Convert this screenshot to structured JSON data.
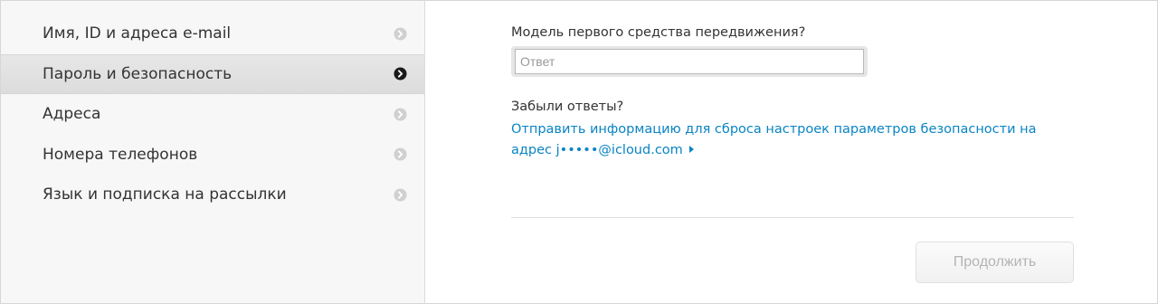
{
  "sidebar": {
    "items": [
      {
        "label": "Имя, ID и адреса e-mail",
        "active": false
      },
      {
        "label": "Пароль и безопасность",
        "active": true
      },
      {
        "label": "Адреса",
        "active": false
      },
      {
        "label": "Номера телефонов",
        "active": false
      },
      {
        "label": "Язык и подписка на рассылки",
        "active": false
      }
    ],
    "chevron_icon": "chevron-right-circle-icon",
    "chevron_color_inactive": "#d0d0d0",
    "chevron_color_active": "#1a1a1a"
  },
  "main": {
    "security_question": "Модель первого средства передвижения?",
    "answer": {
      "value": "",
      "placeholder": "Ответ"
    },
    "forgot_label": "Забыли ответы?",
    "reset_link": "Отправить информацию для сброса настроек параметров безопасности на адрес j•••••@icloud.com",
    "reset_link_icon": "triangle-right-icon",
    "link_color": "#0a84c4",
    "continue_button": {
      "label": "Продолжить",
      "disabled": true
    }
  }
}
